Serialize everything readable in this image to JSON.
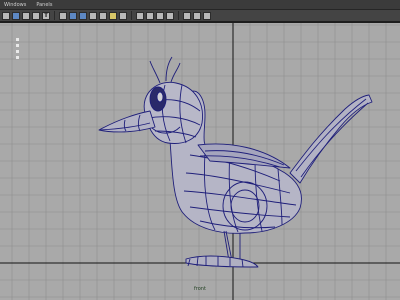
{
  "menu": {
    "items": [
      "Windows",
      "Panels"
    ]
  },
  "toolbar": {
    "buttons": [
      {
        "name": "select-camera-icon",
        "style": "light"
      },
      {
        "name": "camera-attributes-icon",
        "style": "blue"
      },
      {
        "name": "bookmark-icon",
        "style": "light"
      },
      {
        "name": "image-plane-icon",
        "style": "light"
      },
      {
        "name": "text-t-icon",
        "style": "t",
        "glyph": "T"
      },
      {
        "name": "grid-icon",
        "style": "light"
      },
      {
        "name": "film-gate-icon",
        "style": "blue"
      },
      {
        "name": "resolution-gate-icon",
        "style": "blue"
      },
      {
        "name": "gate-mask-icon",
        "style": "light"
      },
      {
        "name": "field-chart-icon",
        "style": "light"
      },
      {
        "name": "safe-action-icon",
        "style": "yellow"
      },
      {
        "name": "safe-title-icon",
        "style": "light"
      },
      {
        "name": "wireframe-icon",
        "style": "light"
      },
      {
        "name": "smooth-shade-icon",
        "style": "light"
      },
      {
        "name": "textured-icon",
        "style": "light"
      },
      {
        "name": "lights-icon",
        "style": "light"
      },
      {
        "name": "xray-icon",
        "style": "light"
      },
      {
        "name": "isolate-select-icon",
        "style": "light"
      },
      {
        "name": "hud-icon",
        "style": "light"
      }
    ]
  },
  "viewport": {
    "camera_label": "front",
    "colors": {
      "background": "#a9a9a9",
      "grid": "#8f8f8f",
      "axis": "#1a1a1a",
      "wire": "#1f1f7a"
    }
  }
}
